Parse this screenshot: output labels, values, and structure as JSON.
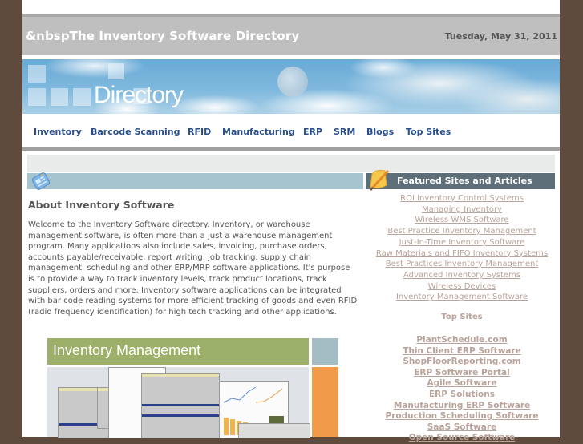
{
  "header": {
    "site_title": "&nbspThe Inventory Software Directory",
    "date": "Tuesday, May 31, 2011"
  },
  "banner": {
    "text": "Directory"
  },
  "nav": {
    "items": [
      {
        "label": "Inventory"
      },
      {
        "label": "Barcode Scanning"
      },
      {
        "label": "RFID"
      },
      {
        "label": "Manufacturing"
      },
      {
        "label": "ERP"
      },
      {
        "label": "SRM"
      },
      {
        "label": "Blogs"
      },
      {
        "label": "Top Sites"
      }
    ]
  },
  "main": {
    "section_title": "About Inventory Software",
    "paragraph": "Welcome to the Inventory Software directory. Inventory, or warehouse management software, is often more than a just a warehouse management program. Many applications also include sales, invoicing, purchase orders, accounts payable/receivable, report writing, job tracking, supply chain management, scheduling and other ERP/MRP software applications. It's purpose is to provide a way to track inventory levels, track product locations, track suppliers, orders and more. Inventory software applications can be integrated with bar code reading systems for more efficient tracking of goods and even RFID (radio frequency identification) for high tech tracking and other applications.",
    "promo_image": {
      "title": "Inventory Management"
    }
  },
  "sidebar": {
    "featured_title": "Featured Sites and Articles",
    "featured_links": [
      {
        "label": "ROI Inventory Control Systems"
      },
      {
        "label": "Managing Inventory"
      },
      {
        "label": "Wireless WMS Software"
      },
      {
        "label": "Best Practice Inventory Management"
      },
      {
        "label": "Just-In-Time Inventory Software"
      },
      {
        "label": "Raw Materials and FIFO Inventory Systems"
      },
      {
        "label": "Best Practices Inventory Management"
      },
      {
        "label": "Advanced Inventory Systems"
      },
      {
        "label": "Wireless Devices"
      },
      {
        "label": "Inventory Management Software"
      }
    ],
    "top_sites_title": "Top Sites",
    "top_sites": [
      {
        "label": "PlantSchedule.com"
      },
      {
        "label": "Thin Client ERP Software"
      },
      {
        "label": "ShopFloorReporting.com"
      },
      {
        "label": "ERP Software Portal"
      },
      {
        "label": "Agile Software"
      },
      {
        "label": "ERP Solutions"
      },
      {
        "label": "Manufacturing ERP Software"
      },
      {
        "label": "Production Scheduling Software"
      },
      {
        "label": "SaaS Software"
      },
      {
        "label": "Open Source Software"
      }
    ]
  },
  "colors": {
    "outer_background": "#5e4b3e",
    "title_bar": "#bfbfbf",
    "nav_link": "#2a4f8c",
    "sidebar_link": "#b9a39a",
    "featured_bar": "#5e6f79",
    "content_bar": "#a6c3d0",
    "promo_green": "#9cb06a",
    "promo_orange": "#ef9b49"
  }
}
